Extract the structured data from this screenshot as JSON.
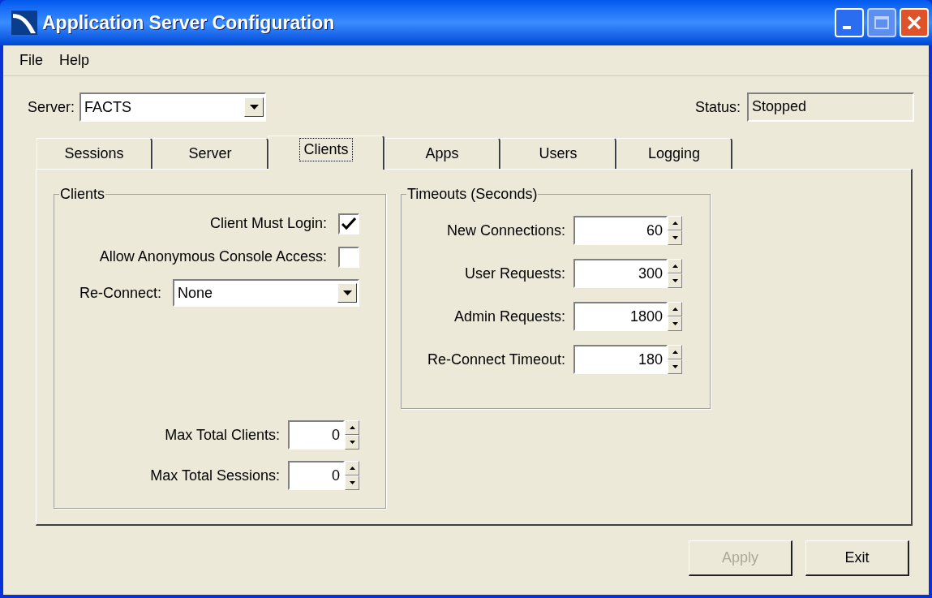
{
  "window": {
    "title": "Application Server Configuration"
  },
  "menu": [
    "File",
    "Help"
  ],
  "server": {
    "label": "Server:",
    "value": "FACTS"
  },
  "status": {
    "label": "Status:",
    "value": "Stopped"
  },
  "tabs": [
    {
      "label": "Sessions",
      "selected": false
    },
    {
      "label": "Server",
      "selected": false
    },
    {
      "label": "Clients",
      "selected": true
    },
    {
      "label": "Apps",
      "selected": false
    },
    {
      "label": "Users",
      "selected": false
    },
    {
      "label": "Logging",
      "selected": false
    }
  ],
  "clients_group": {
    "title": "Clients",
    "rows": [
      {
        "kind": "checkbox",
        "label": "Client Must Login:",
        "checked": true
      },
      {
        "kind": "checkbox",
        "label": "Allow Anonymous Console Access:",
        "checked": false
      },
      {
        "kind": "dropdown",
        "label": "Re-Connect:",
        "value": "None"
      },
      {
        "kind": "spacer"
      },
      {
        "kind": "spin",
        "label": "Max Total Clients:",
        "value": "0"
      },
      {
        "kind": "spin",
        "label": "Max Total Sessions:",
        "value": "0"
      }
    ]
  },
  "timeouts_group": {
    "title": "Timeouts (Seconds)",
    "rows": [
      {
        "kind": "spin",
        "label": "New Connections:",
        "value": "60"
      },
      {
        "kind": "spin",
        "label": "User Requests:",
        "value": "300"
      },
      {
        "kind": "spin",
        "label": "Admin Requests:",
        "value": "1800"
      },
      {
        "kind": "spin",
        "label": "Re-Connect Timeout:",
        "value": "180"
      }
    ]
  },
  "buttons": [
    {
      "label": "Apply",
      "disabled": true
    },
    {
      "label": "Exit",
      "disabled": false
    }
  ]
}
